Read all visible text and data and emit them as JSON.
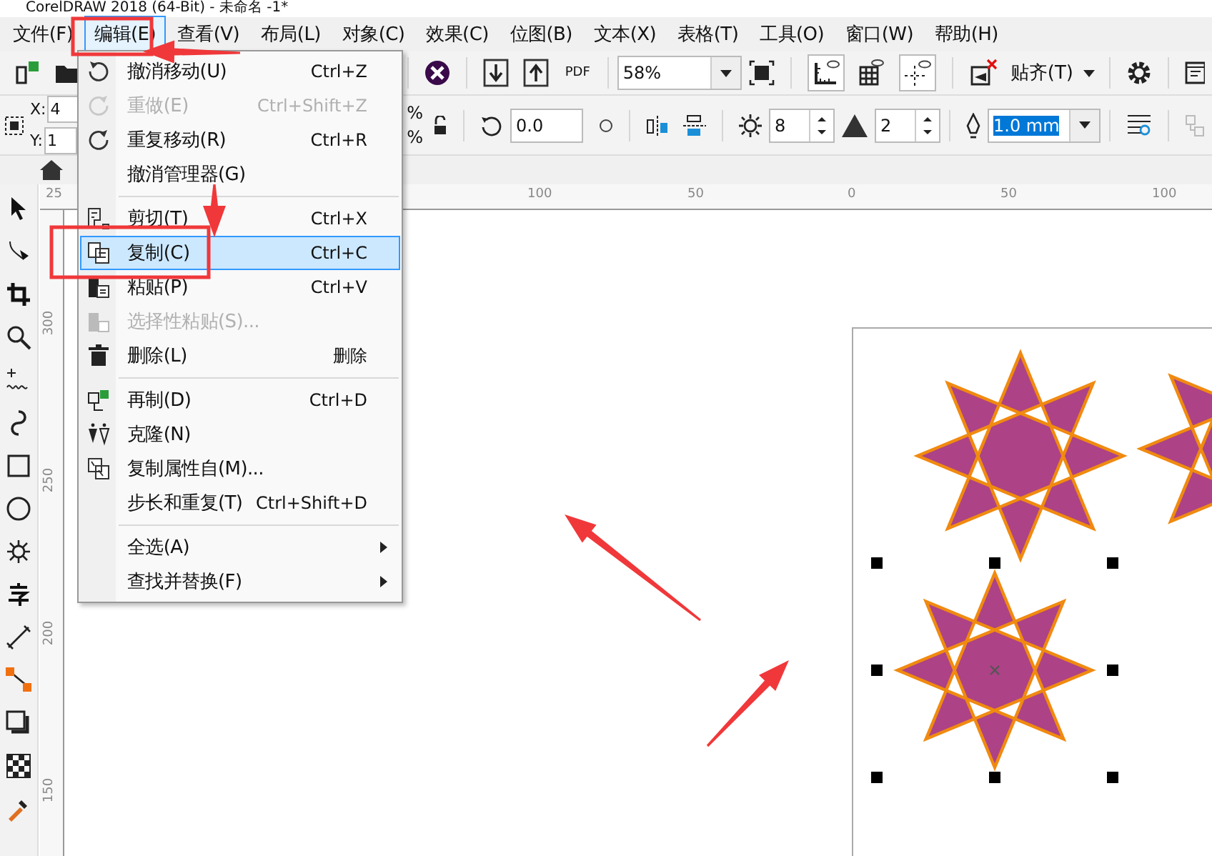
{
  "window": {
    "title": "CorelDRAW 2018 (64-Bit) - 未命名 -1*"
  },
  "menu_bar": [
    {
      "label": "文件(F)",
      "selected": false
    },
    {
      "label": "编辑(E)",
      "selected": true
    },
    {
      "label": "查看(V)",
      "selected": false
    },
    {
      "label": "布局(L)",
      "selected": false
    },
    {
      "label": "对象(C)",
      "selected": false
    },
    {
      "label": "效果(C)",
      "selected": false
    },
    {
      "label": "位图(B)",
      "selected": false
    },
    {
      "label": "文本(X)",
      "selected": false
    },
    {
      "label": "表格(T)",
      "selected": false
    },
    {
      "label": "工具(O)",
      "selected": false
    },
    {
      "label": "窗口(W)",
      "selected": false
    },
    {
      "label": "帮助(H)",
      "selected": false
    }
  ],
  "toolbar": {
    "zoom": "58%",
    "snap": "贴齐(T)",
    "pdf": "PDF"
  },
  "property_bar": {
    "x_label": "X:",
    "x_value": "4",
    "y_label": "Y:",
    "y_value": "1",
    "percent": [
      "%",
      "%"
    ],
    "rotation": "0.0",
    "points": "8",
    "sharpness": "2",
    "outline": "1.0 mm"
  },
  "rulers": {
    "horizontal": [
      "25",
      "100",
      "50",
      "0",
      "50",
      "100"
    ],
    "vertical": [
      "300",
      "250",
      "200",
      "150"
    ]
  },
  "edit_menu": [
    {
      "kind": "item",
      "label": "撤消移动(U)",
      "shortcut": "Ctrl+Z",
      "disabled": false,
      "selected": false,
      "submenu": false
    },
    {
      "kind": "item",
      "label": "重做(E)",
      "shortcut": "Ctrl+Shift+Z",
      "disabled": true,
      "selected": false,
      "submenu": false
    },
    {
      "kind": "item",
      "label": "重复移动(R)",
      "shortcut": "Ctrl+R",
      "disabled": false,
      "selected": false,
      "submenu": false
    },
    {
      "kind": "item",
      "label": "撤消管理器(G)",
      "disabled": false,
      "selected": false,
      "submenu": false
    },
    {
      "kind": "separator"
    },
    {
      "kind": "item",
      "label": "剪切(T)",
      "shortcut": "Ctrl+X",
      "disabled": false,
      "selected": false,
      "submenu": false
    },
    {
      "kind": "item",
      "label": "复制(C)",
      "shortcut": "Ctrl+C",
      "disabled": false,
      "selected": true,
      "submenu": false
    },
    {
      "kind": "item",
      "label": "粘贴(P)",
      "shortcut": "Ctrl+V",
      "disabled": false,
      "selected": false,
      "submenu": false
    },
    {
      "kind": "item",
      "label": "选择性粘贴(S)...",
      "disabled": true,
      "selected": false,
      "submenu": false
    },
    {
      "kind": "item",
      "label": "删除(L)",
      "shortcut": "删除",
      "disabled": false,
      "selected": false,
      "submenu": false
    },
    {
      "kind": "separator"
    },
    {
      "kind": "item",
      "label": "再制(D)",
      "shortcut": "Ctrl+D",
      "disabled": false,
      "selected": false,
      "submenu": false
    },
    {
      "kind": "item",
      "label": "克隆(N)",
      "disabled": false,
      "selected": false,
      "submenu": false
    },
    {
      "kind": "item",
      "label": "复制属性自(M)...",
      "disabled": false,
      "selected": false,
      "submenu": false
    },
    {
      "kind": "item",
      "label": "步长和重复(T)",
      "shortcut": "Ctrl+Shift+D",
      "disabled": false,
      "selected": false,
      "submenu": false
    },
    {
      "kind": "separator"
    },
    {
      "kind": "item",
      "label": "全选(A)",
      "disabled": false,
      "selected": false,
      "submenu": true
    },
    {
      "kind": "item",
      "label": "查找并替换(F)",
      "disabled": false,
      "selected": false,
      "submenu": true
    }
  ],
  "canvas": {
    "stars": [
      {
        "selected": false
      },
      {
        "selected": false
      },
      {
        "selected": true
      }
    ]
  }
}
